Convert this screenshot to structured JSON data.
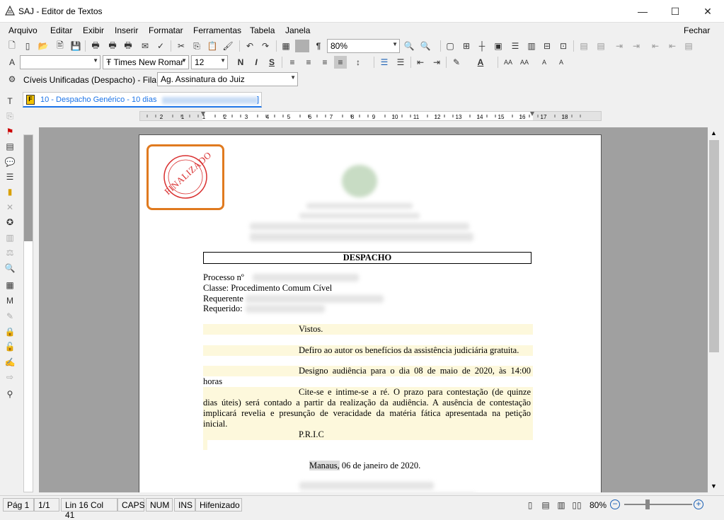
{
  "window": {
    "title": "SAJ - Editor de Textos",
    "minimize": "—",
    "maximize": "☐",
    "close": "✕"
  },
  "menu": {
    "items": [
      "Arquivo",
      "Editar",
      "Exibir",
      "Inserir",
      "Formatar",
      "Ferramentas",
      "Tabela",
      "Janela"
    ],
    "close_label": "Fechar"
  },
  "toolbar": {
    "zoom": "80%",
    "font_name": "Times New Romar",
    "font_size": "12",
    "font_style_value": "",
    "bold": "N",
    "italic": "I",
    "underline": "S"
  },
  "queue_bar": {
    "group": "Cíveis Unificadas (Despacho) - Fila:",
    "queue_value": "Ag. Assinatura do Juiz"
  },
  "tab": {
    "label": "10 - Despacho Genérico - 10 dias",
    "suffix": "]"
  },
  "ruler": {
    "marks": [
      "2",
      "1",
      "1",
      "2",
      "3",
      "4",
      "5",
      "6",
      "7",
      "8",
      "9",
      "10",
      "11",
      "12",
      "13",
      "14",
      "15",
      "16",
      "17",
      "18"
    ]
  },
  "stamp": {
    "text": "FINALIZADO"
  },
  "document": {
    "heading": "DESPACHO",
    "processo_label": "Processo nº",
    "classe_label": "Classe:",
    "classe_value": "Procedimento Comum Cível",
    "requerente_label": "Requerente",
    "requerido_label": "Requerido:",
    "vistos": "Vistos.",
    "p1": "Defiro ao autor os benefícios da assistência judiciária gratuita.",
    "p2_line1": "Designo audiência para o dia 08 de maio de 2020, às 14:00",
    "p2_line2": "horas",
    "p3_line1": "Cite-se e intime-se a ré. O prazo para contestação (de quinze",
    "p3_line2": "dias úteis) será contado a partir da realização da audiência. A ausência de contestação",
    "p3_line3": "implicará revelia e presunção de veracidade da matéria fática apresentada na petição",
    "p3_line4": "inicial.",
    "pric": "P.R.I.C",
    "date_place": "Manaus,",
    "date": "06 de janeiro de 2020."
  },
  "status": {
    "page": "Pág 1",
    "pages": "1/1",
    "position": "Lin 16 Col 41",
    "caps": "CAPS",
    "num": "NUM",
    "ins": "INS",
    "hyphen": "Hifenizado",
    "zoom": "80%"
  }
}
